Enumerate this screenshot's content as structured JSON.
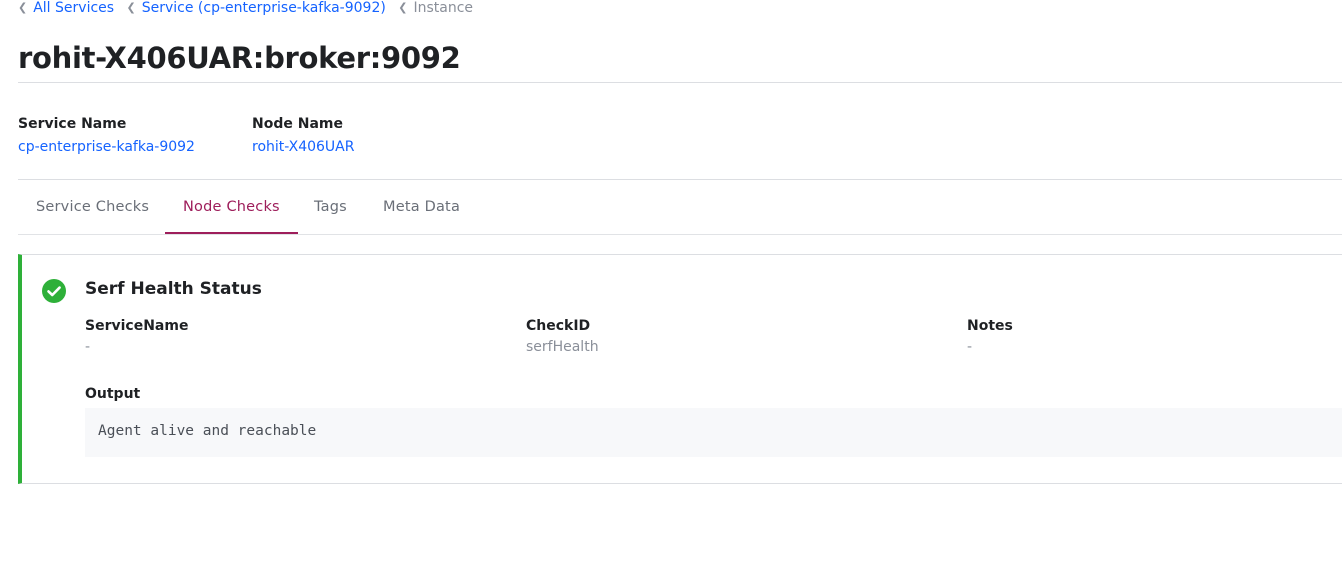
{
  "breadcrumb": {
    "items": [
      {
        "label": "All Services"
      },
      {
        "label": "Service (cp-enterprise-kafka-9092)"
      },
      {
        "label": "Instance"
      }
    ]
  },
  "page": {
    "title": "rohit-X406UAR:broker:9092"
  },
  "details": {
    "service_name_label": "Service Name",
    "service_name_value": "cp-enterprise-kafka-9092",
    "node_name_label": "Node Name",
    "node_name_value": "rohit-X406UAR"
  },
  "tabs": [
    {
      "label": "Service Checks",
      "active": false
    },
    {
      "label": "Node Checks",
      "active": true
    },
    {
      "label": "Tags",
      "active": false
    },
    {
      "label": "Meta Data",
      "active": false
    }
  ],
  "check": {
    "status_icon": "check-circle-icon",
    "status_color": "#2eb039",
    "title": "Serf Health Status",
    "fields": [
      {
        "label": "ServiceName",
        "value": "-"
      },
      {
        "label": "CheckID",
        "value": "serfHealth"
      },
      {
        "label": "Notes",
        "value": "-"
      }
    ],
    "output_label": "Output",
    "output_text": "Agent alive and reachable"
  },
  "colors": {
    "link": "#1563ff",
    "active_tab": "#9e1e5b",
    "passing": "#2eb039"
  }
}
